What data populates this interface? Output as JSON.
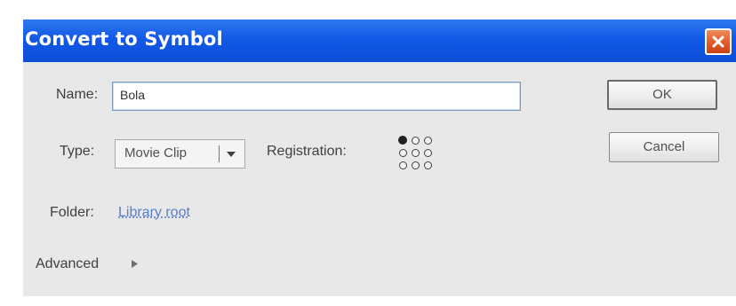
{
  "dialog": {
    "title": "Convert to Symbol",
    "name_label": "Name:",
    "name_value": "Bola",
    "type_label": "Type:",
    "type_value": "Movie Clip",
    "registration_label": "Registration:",
    "registration_selected": "top-left",
    "folder_label": "Folder:",
    "folder_link": "Library root",
    "advanced_label": "Advanced",
    "ok_label": "OK",
    "cancel_label": "Cancel"
  },
  "icons": {
    "close": "close-icon",
    "dropdown": "chevron-down-icon",
    "advanced": "triangle-right-icon"
  },
  "colors": {
    "titlebar": "#1359e6",
    "close_button": "#e05a2a",
    "dialog_bg": "#e8e8e8",
    "link": "#5a7fc8"
  }
}
